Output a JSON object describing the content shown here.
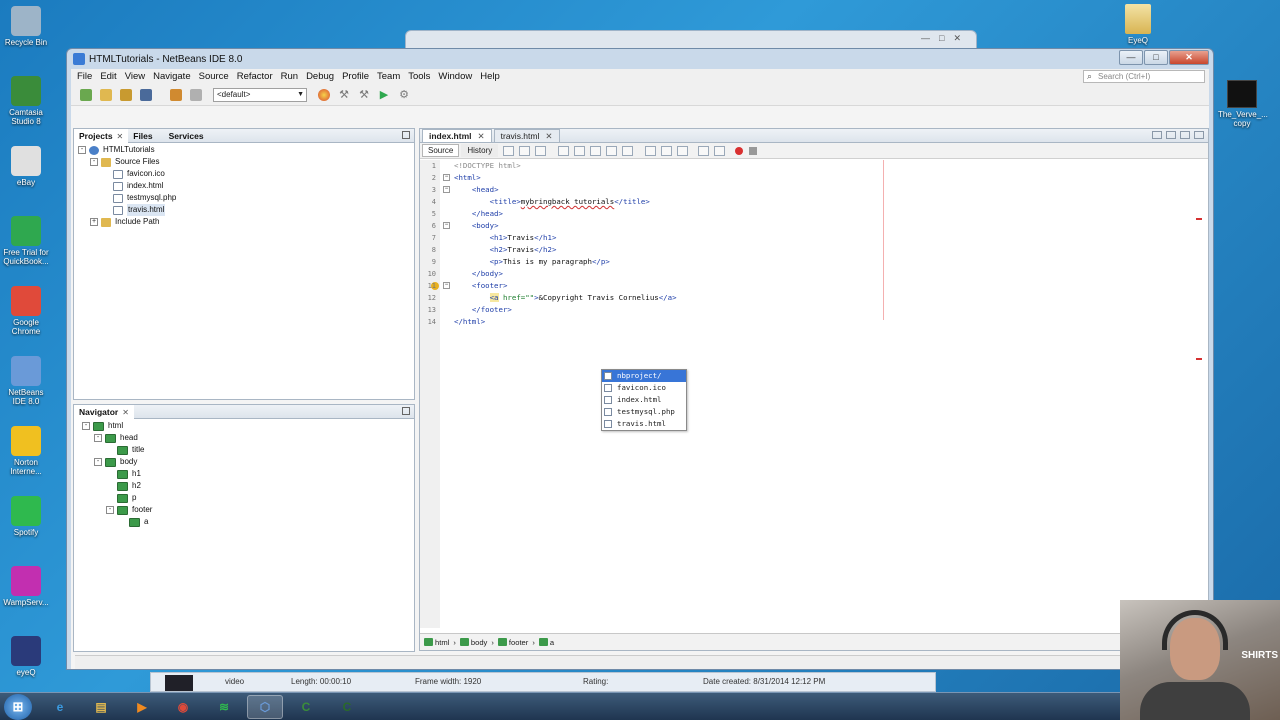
{
  "desktop": {
    "left_icons": [
      {
        "label": "Recycle Bin",
        "icon": "recycle-bin-icon",
        "color": "#9db4c8"
      },
      {
        "label": "Camtasia Studio 8",
        "icon": "camtasia-icon",
        "color": "#3a8c3a"
      },
      {
        "label": "eBay",
        "icon": "ebay-icon",
        "color": "#e0e0e0"
      },
      {
        "label": "Free Trial for QuickBook...",
        "icon": "quickbooks-icon",
        "color": "#2fa84f"
      },
      {
        "label": "Google Chrome",
        "icon": "chrome-icon",
        "color": "#e04a3a"
      },
      {
        "label": "NetBeans IDE 8.0",
        "icon": "netbeans-icon",
        "color": "#6a9ad8"
      },
      {
        "label": "Norton Interne...",
        "icon": "norton-icon",
        "color": "#f0c020"
      },
      {
        "label": "Spotify",
        "icon": "spotify-icon",
        "color": "#2fb94e"
      },
      {
        "label": "WampServ...",
        "icon": "wampserver-icon",
        "color": "#c22fb0"
      },
      {
        "label": "eyeQ",
        "icon": "eyeq-icon",
        "color": "#2a3a7a"
      }
    ],
    "right_icons": [
      {
        "label": "EyeQ",
        "icon": "folder-icon"
      },
      {
        "label": "The_Verve_... copy",
        "icon": "video-file-icon"
      }
    ]
  },
  "window": {
    "title": "HTMLTutorials - NetBeans IDE 8.0",
    "controls": {
      "minimize": "—",
      "maximize": "□",
      "close": "✕"
    }
  },
  "menu": [
    "File",
    "Edit",
    "View",
    "Navigate",
    "Source",
    "Refactor",
    "Run",
    "Debug",
    "Profile",
    "Team",
    "Tools",
    "Window",
    "Help"
  ],
  "search": {
    "placeholder": "Search (Ctrl+I)"
  },
  "toolbar": {
    "config": "<default>",
    "buttons": [
      {
        "icon": "new-file-icon",
        "color": "#6aa84f"
      },
      {
        "icon": "new-project-icon",
        "color": "#e0b850"
      },
      {
        "icon": "open-project-icon",
        "color": "#c89a30"
      },
      {
        "icon": "save-all-icon",
        "color": "#4a6a9a"
      },
      {
        "icon": "undo-icon",
        "color": "#d08a30"
      },
      {
        "icon": "redo-icon",
        "color": "#b0b0b0"
      }
    ]
  },
  "projects_panel": {
    "tabs": [
      "Projects",
      "Files",
      "Services"
    ],
    "tree": [
      {
        "label": "HTMLTutorials",
        "indent": 0,
        "toggle": "-",
        "icon": "project-icon"
      },
      {
        "label": "Source Files",
        "indent": 1,
        "toggle": "-",
        "icon": "folder-icon"
      },
      {
        "label": "favicon.ico",
        "indent": 2,
        "toggle": "",
        "icon": "file-icon"
      },
      {
        "label": "index.html",
        "indent": 2,
        "toggle": "",
        "icon": "file-icon"
      },
      {
        "label": "testmysql.php",
        "indent": 2,
        "toggle": "",
        "icon": "file-icon"
      },
      {
        "label": "travis.html",
        "indent": 2,
        "toggle": "",
        "icon": "file-icon",
        "selected": true
      },
      {
        "label": "Include Path",
        "indent": 1,
        "toggle": "+",
        "icon": "folder-icon"
      }
    ]
  },
  "navigator_panel": {
    "title": "Navigator",
    "tree": [
      {
        "label": "html",
        "indent": 0,
        "toggle": "-"
      },
      {
        "label": "head",
        "indent": 1,
        "toggle": "-"
      },
      {
        "label": "title",
        "indent": 2,
        "toggle": ""
      },
      {
        "label": "body",
        "indent": 1,
        "toggle": "-"
      },
      {
        "label": "h1",
        "indent": 2,
        "toggle": ""
      },
      {
        "label": "h2",
        "indent": 2,
        "toggle": ""
      },
      {
        "label": "p",
        "indent": 2,
        "toggle": ""
      },
      {
        "label": "footer",
        "indent": 2,
        "toggle": "-"
      },
      {
        "label": "a",
        "indent": 3,
        "toggle": ""
      }
    ]
  },
  "editor": {
    "tabs": [
      {
        "label": "index.html",
        "active": true
      },
      {
        "label": "travis.html",
        "active": false
      }
    ],
    "modes": [
      "Source",
      "History"
    ],
    "lines": [
      {
        "n": "1",
        "code": "<!DOCTYPE html>"
      },
      {
        "n": "2",
        "code": "<html>"
      },
      {
        "n": "3",
        "code": "    <head>"
      },
      {
        "n": "4",
        "code": "        <title>mybringback tutorials</title>"
      },
      {
        "n": "5",
        "code": "    </head>"
      },
      {
        "n": "6",
        "code": "    <body>"
      },
      {
        "n": "7",
        "code": "        <h1>Travis</h1>"
      },
      {
        "n": "8",
        "code": "        <h2>Travis</h2>"
      },
      {
        "n": "9",
        "code": "        <p>This is my paragraph</p>"
      },
      {
        "n": "10",
        "code": "    </body>"
      },
      {
        "n": "11",
        "code": "    <footer>"
      },
      {
        "n": "12",
        "code": "        <a href=\"\">&Copyright Travis Cornelius</a>"
      },
      {
        "n": "13",
        "code": "    </footer>"
      },
      {
        "n": "14",
        "code": "</html>"
      }
    ],
    "completion": [
      {
        "label": "nbproject/",
        "selected": true
      },
      {
        "label": "favicon.ico",
        "selected": false
      },
      {
        "label": "index.html",
        "selected": false
      },
      {
        "label": "testmysql.php",
        "selected": false
      },
      {
        "label": "travis.html",
        "selected": false
      }
    ],
    "breadcrumbs": [
      "html",
      "body",
      "footer",
      "a"
    ]
  },
  "explorer_strip": {
    "name": "video",
    "length": "Length: 00:00:10",
    "frame_width": "Frame width: 1920",
    "rating": "Rating:",
    "date_created": "Date created: 8/31/2014 12:12 PM"
  },
  "taskbar": {
    "start": "⊞",
    "apps": [
      {
        "icon": "internet-explorer-icon",
        "glyph": "e",
        "color": "#3a9ae0"
      },
      {
        "icon": "file-explorer-icon",
        "glyph": "▤",
        "color": "#e0b850"
      },
      {
        "icon": "media-player-icon",
        "glyph": "▶",
        "color": "#f08a20"
      },
      {
        "icon": "chrome-icon",
        "glyph": "◉",
        "color": "#e04a3a"
      },
      {
        "icon": "spotify-icon",
        "glyph": "≋",
        "color": "#2fb94e"
      },
      {
        "icon": "netbeans-icon",
        "glyph": "⬡",
        "color": "#6a9ad8",
        "active": true
      },
      {
        "icon": "camtasia-recorder-icon",
        "glyph": "C",
        "color": "#3a8c3a"
      },
      {
        "icon": "camtasia-studio-icon",
        "glyph": "C",
        "color": "#2a6a2a"
      }
    ]
  },
  "webcam": {
    "watermark": "SHIRTS"
  }
}
